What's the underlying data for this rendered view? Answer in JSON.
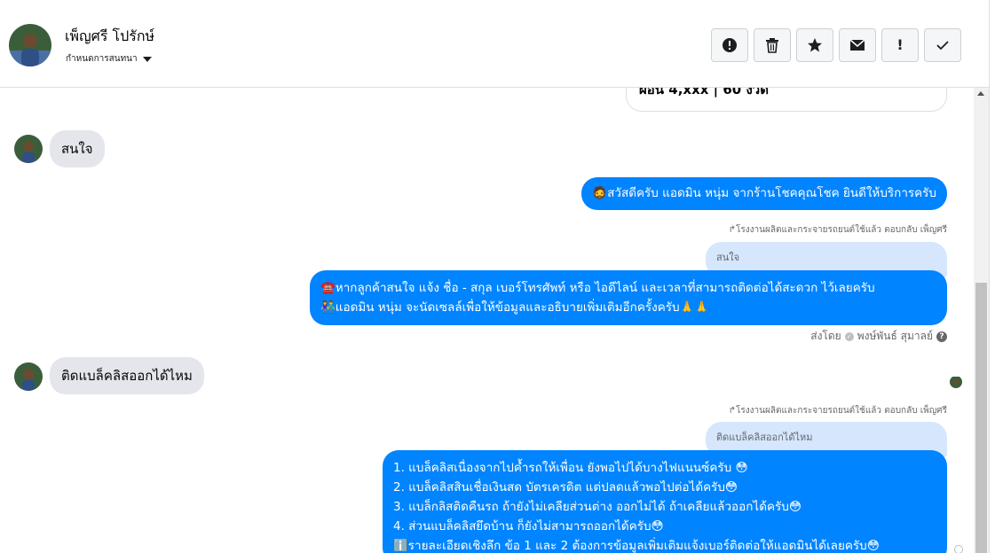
{
  "header": {
    "contact_name": "เพ็ญศรี โปรักษ์",
    "assign_label": "กำหนดการสนทนา",
    "actions": [
      {
        "icon": "alert-circle-icon",
        "glyph": "!"
      },
      {
        "icon": "trash-icon",
        "glyph": "🗑"
      },
      {
        "icon": "star-icon",
        "glyph": "★"
      },
      {
        "icon": "envelope-icon",
        "glyph": "✉"
      },
      {
        "icon": "exclamation-icon",
        "glyph": "!"
      },
      {
        "icon": "check-icon",
        "glyph": "✓"
      }
    ]
  },
  "messages": {
    "prev_card_text": "ผ่อน 4,xxx | 60 งวด",
    "in_1": "สนใจ",
    "out_1": "🧔สวัสดีครับ แอดมิน หนุ่ม จากร้านโชคคุณโชค ยินดีให้บริการครับ",
    "reply_1": "↱โรงงานผลิตและกระจายรถยนต์ใช้แล้ว ตอบกลับ เพ็ญศรี",
    "quote_1": "สนใจ",
    "out_2_line1": "☎️หากลูกค้าสนใจ แจ้ง ชื่อ - สกุล เบอร์โทรศัพท์ หรือ ไอดีไลน์ และเวลาที่สามารถติดต่อได้สะดวก ไว้เลยครับ",
    "out_2_line2": "👫แอดมิน หนุ่ม จะนัดเซลล์เพื่อให้ข้อมูลและอธิบายเพิ่มเติมอีกครั้งครับ🙏🙏",
    "sent_by_label": "ส่งโดย",
    "sent_by_name": "พงษ์พันธ์ สุมาลย์",
    "in_2": "ติดแบล็คลิสออกได้ไหม",
    "reply_2": "↱โรงงานผลิตและกระจายรถยนต์ใช้แล้ว ตอบกลับ เพ็ญศรี",
    "quote_2": "ติดแบล็คลิสออกได้ไหม",
    "out_3_lines": [
      "1. แบล็คลิสเนื่องจากไปค้ำรถให้เพื่อน ยังพอไปได้บางไฟแนนซ์ครับ 😳",
      "2. แบล็คลิสสินเชื่อเงินสด บัตรเครดิต แต่ปลดแล้วพอไปต่อได้ครับ😳",
      "3. แบล็กลิสติดคืนรถ ถ้ายังไม่เคลียส่วนต่าง ออกไม่ได้ ถ้าเคลียแล้วออกได้ครับ😳",
      "4. ส่วนแบล็คลิสยึดบ้าน ก็ยังไม่สามารถออกได้ครับ😳",
      "ℹ️รายละเอียดเชิงลึก ข้อ 1 และ 2 ต้องการข้อมูลเพิ่มเติมแจ้งเบอร์ติดต่อให้แอดมินได้เลยครับ😳"
    ]
  },
  "colors": {
    "outgoing_bubble": "#0084ff",
    "incoming_bubble": "#e4e6eb",
    "quote_bubble": "#d5e6fd"
  }
}
